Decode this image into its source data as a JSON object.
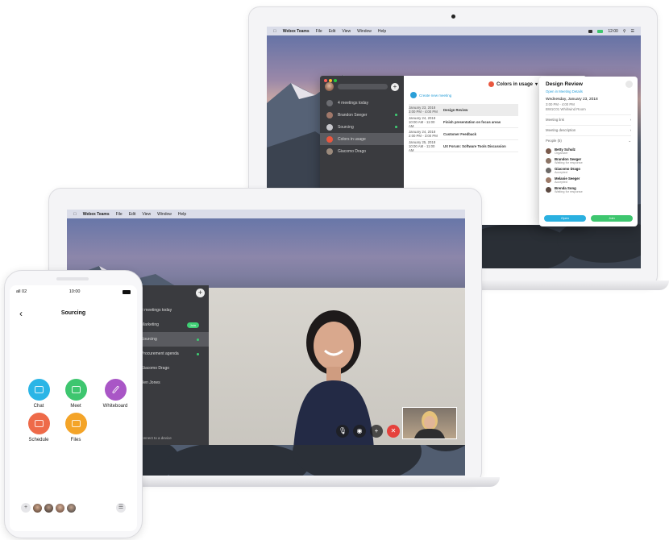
{
  "laptop_back": {
    "menubar": {
      "app": "Webex Teams",
      "items": [
        "File",
        "Edit",
        "View",
        "Window",
        "Help"
      ],
      "clock": "12:00"
    },
    "sidebar": {
      "items": [
        {
          "label": "4 meetings today"
        },
        {
          "label": "Brandon Seeger"
        },
        {
          "label": "Sourcing"
        },
        {
          "label": "Colors in usage"
        },
        {
          "label": "Giacomo Drago"
        }
      ],
      "connect": "Connect to a device"
    },
    "space_title": "Colors in usage",
    "create_meeting": "Create new meeting",
    "meetings": [
      {
        "date": "January 23, 2018",
        "time": "3:00 PM - 4:00 PM",
        "title": "Design Review"
      },
      {
        "date": "January 24, 2018",
        "time": "10:00 AM - 11:00 AM",
        "title": "Finish presentation on focus areas"
      },
      {
        "date": "January 24, 2018",
        "time": "2:00 PM - 3:00 PM",
        "title": "Customer Feedback"
      },
      {
        "date": "January 25, 2018",
        "time": "10:00 AM - 11:00 AM",
        "title": "UX Forum: Software Tools Discussion"
      }
    ],
    "popover": {
      "title": "Design Review",
      "link": "Open in Meeting Details",
      "date": "Wednesday, January 23, 2018",
      "time": "3:00 PM - 4:00 PM",
      "location": "BW1C01 Whirlwind Room",
      "fields": [
        "Meeting link",
        "Meeting description",
        "People (5)"
      ],
      "people": [
        {
          "name": "Betty Schulz",
          "status": "Organizer"
        },
        {
          "name": "Brandon Seeger",
          "status": "Waiting for response"
        },
        {
          "name": "Giacomo Drago",
          "status": "Accepted"
        },
        {
          "name": "Melanie Seeger",
          "status": "Accepted"
        },
        {
          "name": "Brenda Song",
          "status": "Waiting for response"
        }
      ],
      "buttons": [
        "Open",
        "Join"
      ]
    }
  },
  "laptop_front": {
    "menubar": {
      "app": "Webex Teams",
      "items": [
        "File",
        "Edit",
        "View",
        "Window",
        "Help"
      ]
    },
    "sidebar": {
      "items": [
        {
          "label": "4 meetings today"
        },
        {
          "label": "Marketing",
          "badge": "Join"
        },
        {
          "label": "Sourcing"
        },
        {
          "label": "Procurement agenda"
        },
        {
          "label": "Giacomo Drago"
        },
        {
          "label": "Ben Jones"
        }
      ],
      "connect": "Connect to a device"
    }
  },
  "phone": {
    "carrier": "all 02",
    "time": "10:00",
    "title": "Sourcing",
    "tiles": [
      {
        "label": "Chat",
        "color": "#2bb5e6"
      },
      {
        "label": "Meet",
        "color": "#3ec66f"
      },
      {
        "label": "Whiteboard",
        "color": "#a956c6"
      },
      {
        "label": "Schedule",
        "color": "#ee6a49"
      },
      {
        "label": "Files",
        "color": "#f4a428"
      }
    ]
  }
}
